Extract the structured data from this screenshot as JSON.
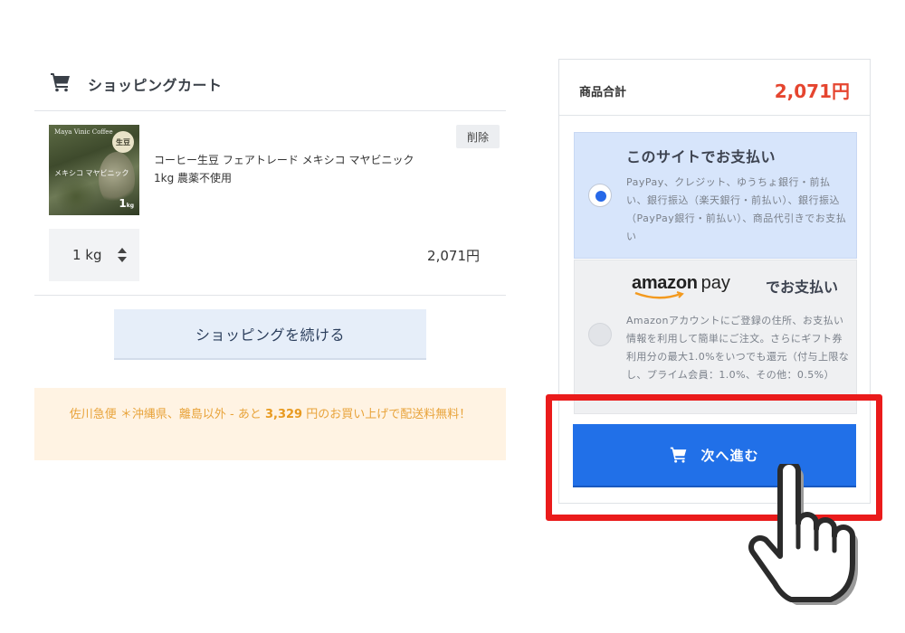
{
  "cart": {
    "title": "ショッピングカート",
    "icon": "cart-icon"
  },
  "product": {
    "image": {
      "brand_text": "Maya Vinic Coffee",
      "badge": "生豆",
      "name_on_image": "メキシコ マヤビニック",
      "weight_number": "1",
      "weight_unit": "kg"
    },
    "name_line1": "コーヒー生豆 フェアトレード メキシコ マヤビニック",
    "name_line2": "1kg 農薬不使用",
    "delete_label": "削除",
    "quantity": "1 kg",
    "price": "2,071円"
  },
  "continue_label": "ショッピングを続ける",
  "shipping_notice": {
    "prefix": "佐川急便 ＊沖縄県、離島以外 - あと ",
    "amount": "3,329",
    "suffix": " 円のお買い上げで配送料無料！"
  },
  "summary": {
    "subtotal_label": "商品合計",
    "subtotal_value": "2,071円",
    "subtotal_color": "#e5452f"
  },
  "payment_options": [
    {
      "title": "このサイトでお支払い",
      "description": "PayPay、クレジット、ゆうちょ銀行・前払い、銀行振込（楽天銀行・前払い）、銀行振込（PayPay銀行・前払い）、商品代引きでお支払い",
      "selected": true
    },
    {
      "logo_word": "amazon",
      "logo_pay": "pay",
      "title_suffix": "でお支払い",
      "description": "Amazonアカウントにご登録の住所、お支払い情報を利用して簡単にご注文。さらにギフト券利用分の最大1.0%をいつでも還元（付与上限なし、プライム会員：1.0%、その他：0.5%）",
      "selected": false
    }
  ],
  "next_button": {
    "label": "次へ進む",
    "icon": "cart-icon",
    "color": "#2170e8"
  },
  "colors": {
    "accent": "#2170e8",
    "highlight": "#ea1b1b",
    "notice_bg": "#fff3e3",
    "notice_text": "#e8a33a"
  }
}
